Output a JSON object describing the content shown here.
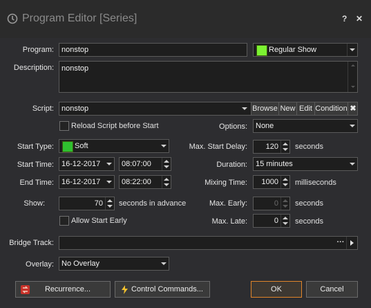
{
  "window": {
    "title": "Program Editor [Series]",
    "help": "?",
    "close": "✕"
  },
  "labels": {
    "program": "Program:",
    "description": "Description:",
    "script": "Script:",
    "start_type": "Start Type:",
    "start_time": "Start Time:",
    "end_time": "End Time:",
    "show": "Show:",
    "bridge_track": "Bridge Track:",
    "overlay": "Overlay:",
    "options": "Options:",
    "max_start_delay": "Max. Start Delay:",
    "duration": "Duration:",
    "mixing_time": "Mixing Time:",
    "max_early": "Max. Early:",
    "max_late": "Max. Late:"
  },
  "fields": {
    "program": "nonstop",
    "program_type": "Regular Show",
    "program_type_color": "#7cf232",
    "description": "nonstop",
    "script": "nonstop",
    "reload_script": "Reload Script before Start",
    "options": "None",
    "start_type": "Soft",
    "start_type_color": "#2fbf2f",
    "max_start_delay": "120",
    "start_date": "16-12-2017",
    "start_clock": "08:07:00",
    "duration": "15 minutes",
    "end_date": "16-12-2017",
    "end_clock": "08:22:00",
    "mixing_time": "1000",
    "show": "70",
    "show_unit": "seconds in advance",
    "max_early": "0",
    "allow_start_early": "Allow Start Early",
    "max_late": "0",
    "bridge_track": "",
    "bridge_browse": "···",
    "overlay": "No Overlay"
  },
  "units": {
    "seconds": "seconds",
    "milliseconds": "milliseconds"
  },
  "script_buttons": {
    "browse": "Browse",
    "new": "New",
    "edit": "Edit",
    "condition": "Condition",
    "clear": "✖"
  },
  "footer": {
    "recurrence": "Recurrence...",
    "control_commands": "Control Commands...",
    "ok": "OK",
    "cancel": "Cancel"
  }
}
